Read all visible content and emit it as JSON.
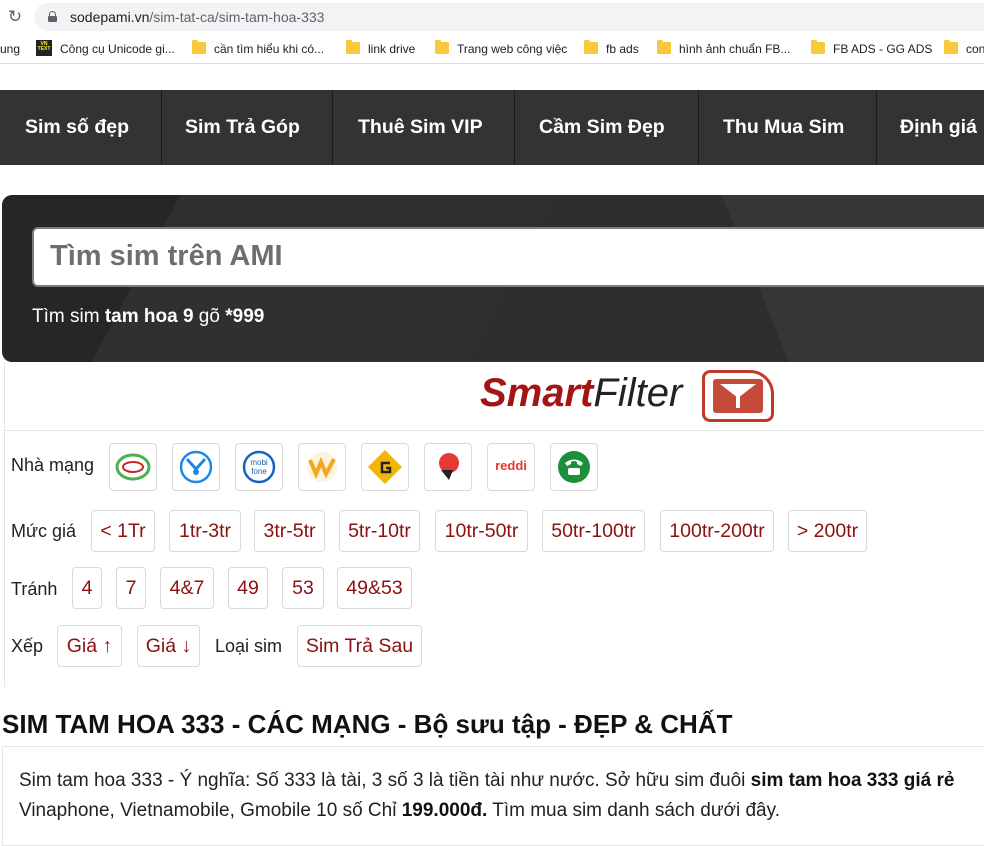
{
  "browser": {
    "url_host": "sodepami.vn",
    "url_path": "/sim-tat-ca/sim-tam-hoa-333",
    "bookmarks": [
      {
        "label": "ung",
        "icon": "truncated"
      },
      {
        "label": "Công cụ Unicode gi...",
        "icon": "vietnamese-text-favicon"
      },
      {
        "label": "cần tìm hiểu khi có...",
        "icon": "folder-icon"
      },
      {
        "label": "link drive",
        "icon": "folder-icon"
      },
      {
        "label": "Trang web công việc",
        "icon": "folder-icon"
      },
      {
        "label": "fb ads",
        "icon": "folder-icon"
      },
      {
        "label": "hình ảnh chuẩn FB...",
        "icon": "folder-icon"
      },
      {
        "label": "FB ADS - GG ADS",
        "icon": "folder-icon"
      },
      {
        "label": "con",
        "icon": "folder-icon"
      }
    ]
  },
  "nav": {
    "items": [
      "Sim số đẹp",
      "Sim Trả Góp",
      "Thuê Sim VIP",
      "Cầm Sim Đẹp",
      "Thu Mua Sim",
      "Định giá"
    ]
  },
  "search": {
    "placeholder": "Tìm sim trên AMI",
    "hint_prefix": "Tìm sim ",
    "hint_bold": "tam hoa 9",
    "hint_mid": " gõ ",
    "hint_code": "*999"
  },
  "smartfilter": {
    "title_smart": "Smart",
    "title_filter": "Filter",
    "carrier_label": "Nhà mạng",
    "carriers": [
      {
        "name": "Viettel",
        "icon": "viettel-logo",
        "color": "#4caf50"
      },
      {
        "name": "Vinaphone",
        "icon": "vinaphone-logo",
        "color": "#1e88e5"
      },
      {
        "name": "Mobifone",
        "icon": "mobifone-logo",
        "color": "#1565c0"
      },
      {
        "name": "Vietnamobile",
        "icon": "vietnamobile-logo",
        "color": "#f5a623"
      },
      {
        "name": "Gmobile",
        "icon": "gmobile-logo",
        "color": "#f2b705"
      },
      {
        "name": "iTel",
        "icon": "itel-logo",
        "color": "#e53935"
      },
      {
        "name": "Reddi",
        "icon": "reddi-logo",
        "color": "#e53935"
      },
      {
        "name": "Máy bàn",
        "icon": "telephone-icon",
        "color": "#1b8f3a"
      }
    ],
    "price_label": "Mức giá",
    "prices": [
      "< 1Tr",
      "1tr-3tr",
      "3tr-5tr",
      "5tr-10tr",
      "10tr-50tr",
      "50tr-100tr",
      "100tr-200tr",
      "> 200tr"
    ],
    "avoid_label": "Tránh",
    "avoid": [
      "4",
      "7",
      "4&7",
      "49",
      "53",
      "49&53"
    ],
    "sort_label": "Xếp",
    "sort": [
      "Giá ↑",
      "Giá ↓"
    ],
    "type_label": "Loại sim",
    "type_value": "Sim Trả Sau"
  },
  "content": {
    "heading": "SIM TAM HOA 333 - CÁC MẠNG - Bộ sưu tập - ĐẸP & CHẤT",
    "para_1a": "Sim tam hoa 333 - Ý nghĩa: Số 333 là tài, 3 số 3 là tiền tài như nước. Sở hữu sim đuôi ",
    "para_1b": "sim tam hoa 333 giá rẻ",
    "para_2a": "Vinaphone, Vietnamobile, Gmobile 10 số Chỉ ",
    "para_2b": "199.000đ.",
    "para_2c": " Tìm mua sim danh sách dưới đây."
  }
}
